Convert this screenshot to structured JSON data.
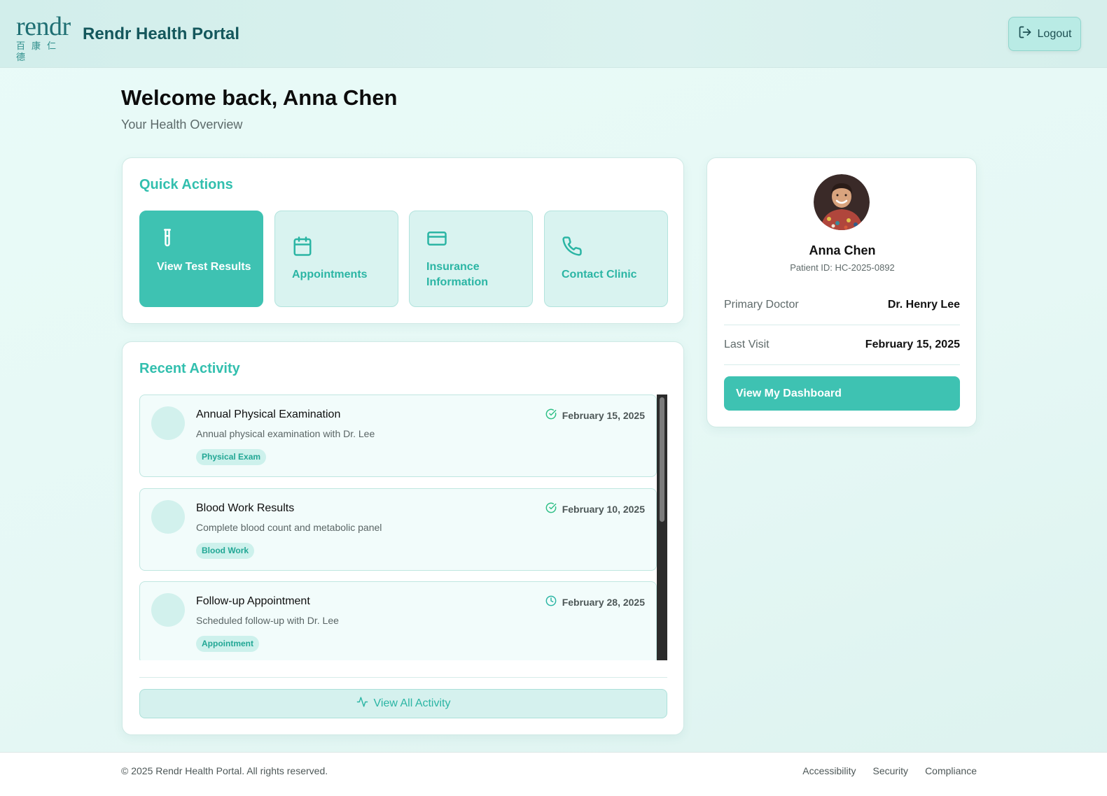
{
  "header": {
    "logo_word": "rendr",
    "logo_cn": "百康仁德",
    "app_title": "Rendr Health Portal",
    "logout_label": "Logout"
  },
  "welcome": {
    "title": "Welcome back, Anna Chen",
    "subtitle": "Your Health Overview"
  },
  "quick_actions": {
    "title": "Quick Actions",
    "items": [
      {
        "label": "View Test Results",
        "icon": "test-tube-icon",
        "active": true
      },
      {
        "label": "Appointments",
        "icon": "calendar-icon",
        "active": false
      },
      {
        "label": "Insurance Information",
        "icon": "credit-card-icon",
        "active": false
      },
      {
        "label": "Contact Clinic",
        "icon": "phone-icon",
        "active": false
      }
    ]
  },
  "recent_activity": {
    "title": "Recent Activity",
    "items": [
      {
        "title": "Annual Physical Examination",
        "description": "Annual physical examination with Dr. Lee",
        "tag": "Physical Exam",
        "date": "February 15, 2025",
        "status_icon": "check-circle-icon"
      },
      {
        "title": "Blood Work Results",
        "description": "Complete blood count and metabolic panel",
        "tag": "Blood Work",
        "date": "February 10, 2025",
        "status_icon": "check-circle-icon"
      },
      {
        "title": "Follow-up Appointment",
        "description": "Scheduled follow-up with Dr. Lee",
        "tag": "Appointment",
        "date": "February 28, 2025",
        "status_icon": "clock-icon"
      }
    ],
    "view_all_label": "View All Activity"
  },
  "profile": {
    "name": "Anna Chen",
    "patient_id": "Patient ID: HC-2025-0892",
    "primary_doctor_label": "Primary Doctor",
    "primary_doctor_value": "Dr. Henry Lee",
    "last_visit_label": "Last Visit",
    "last_visit_value": "February 15, 2025",
    "dashboard_label": "View My Dashboard"
  },
  "footer": {
    "copyright": "© 2025 Rendr Health Portal. All rights reserved.",
    "links": [
      "Accessibility",
      "Security",
      "Compliance"
    ]
  },
  "colors": {
    "accent": "#3ec2b2",
    "accent_text": "#2bb5a4",
    "brand_dark": "#14575c"
  }
}
